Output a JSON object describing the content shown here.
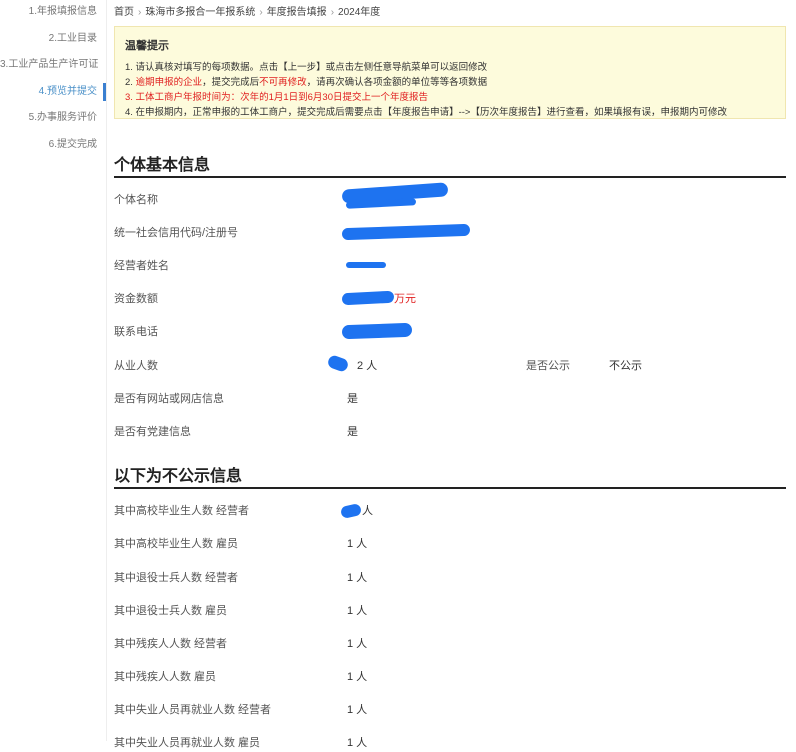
{
  "sidebar": {
    "items": [
      {
        "label": "1.年报填报信息",
        "active": false
      },
      {
        "label": "2.工业目录",
        "active": false
      },
      {
        "label": "3.工业产品生产许可证",
        "active": false
      },
      {
        "label": "4.预览并提交",
        "active": true
      },
      {
        "label": "5.办事服务评价",
        "active": false
      },
      {
        "label": "6.提交完成",
        "active": false
      }
    ]
  },
  "breadcrumb": [
    "首页",
    "珠海市多报合一年报系统",
    "年度报告填报",
    "2024年度"
  ],
  "notice": {
    "title": "温馨提示",
    "line1": "1. 请认真核对填写的每项数据。点击【上一步】或点击左侧任意导航菜单可以返回修改",
    "line2_prefix": "2. ",
    "line2_red1": "逾期申报的企业",
    "line2_mid": "，提交完成后",
    "line2_red2": "不可再修改",
    "line2_suffix": "，请再次确认各项金额的单位等等各项数据",
    "line3": "3. 工体工商户年报时间为：次年的1月1日到6月30日提交上一个年度报告",
    "line4": "4. 在申报期内，正常申报的工体工商户，提交完成后需要点击【年度报告申请】-->【历次年度报告】进行查看，如果填报有误，申报期内可修改"
  },
  "basic": {
    "title": "个体基本信息",
    "name_label": "个体名称",
    "credit_label": "统一社会信用代码/注册号",
    "operator_label": "经营者姓名",
    "capital_label": "资金数额",
    "capital_unit": "万元",
    "phone_label": "联系电话",
    "employees_label": "从业人数",
    "employees_value": "2 人",
    "public_label": "是否公示",
    "public_value": "不公示",
    "website_label": "是否有网站或网店信息",
    "website_value": "是",
    "party_label": "是否有党建信息",
    "party_value": "是"
  },
  "private": {
    "title": "以下为不公示信息",
    "rows": [
      {
        "label": "其中高校毕业生人数 经营者",
        "value": "人"
      },
      {
        "label": "其中高校毕业生人数 雇员",
        "value": "1 人"
      },
      {
        "label": "其中退役士兵人数 经营者",
        "value": "1 人"
      },
      {
        "label": "其中退役士兵人数 雇员",
        "value": "1 人"
      },
      {
        "label": "其中残疾人人数 经营者",
        "value": "1 人"
      },
      {
        "label": "其中残疾人人数 雇员",
        "value": "1 人"
      },
      {
        "label": "其中失业人员再就业人数 经营者",
        "value": "1 人"
      },
      {
        "label": "其中失业人员再就业人数 雇员",
        "value": "1 人"
      }
    ]
  },
  "colors": {
    "accent": "#3a7fd0",
    "warn": "#e02020",
    "notice_bg": "#fdfbdc",
    "redaction": "#1e73f0"
  }
}
